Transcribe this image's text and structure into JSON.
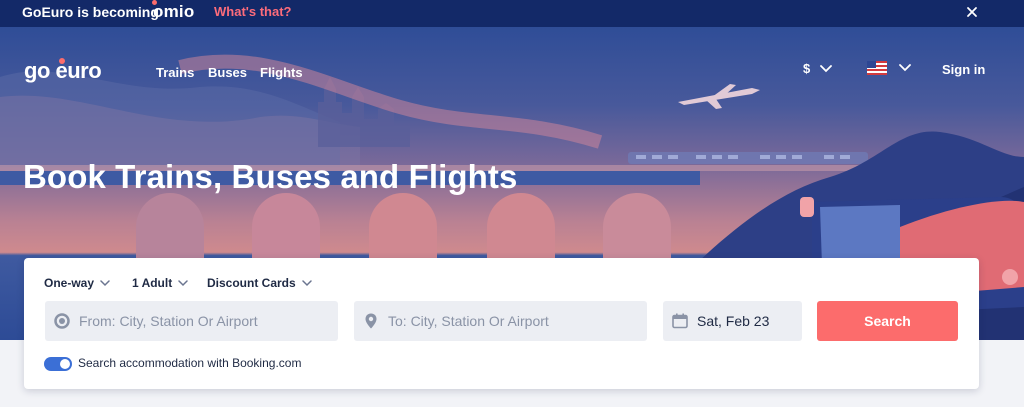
{
  "banner": {
    "text": "GoEuro is becoming",
    "brand": "omio",
    "link": "What's that?",
    "close_icon": "close-icon"
  },
  "header": {
    "logo": "go euro",
    "nav": [
      "Trains",
      "Buses",
      "Flights"
    ],
    "currency": "$",
    "language_icon": "us-flag-icon",
    "sign_in": "Sign in"
  },
  "hero": {
    "headline": "Book Trains, Buses and Flights"
  },
  "search": {
    "trip_type": "One-way",
    "passengers": "1 Adult",
    "discount": "Discount Cards",
    "from_placeholder": "From: City, Station Or Airport",
    "to_placeholder": "To: City, Station Or Airport",
    "date": "Sat, Feb 23",
    "search_label": "Search",
    "accommodation_label": "Search accommodation with Booking.com",
    "accommodation_enabled": true
  },
  "colors": {
    "banner_bg": "#132968",
    "accent": "#fc6c6c",
    "toggle": "#3b6fd6"
  }
}
